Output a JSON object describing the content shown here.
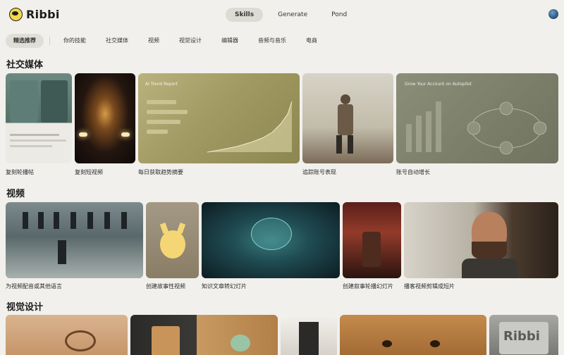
{
  "header": {
    "brand": "Ribbi",
    "tabs": [
      {
        "label": "Skills",
        "active": true
      },
      {
        "label": "Generate",
        "active": false
      },
      {
        "label": "Pond",
        "active": false
      }
    ]
  },
  "categories": [
    {
      "label": "精选推荐",
      "active": true
    },
    {
      "label": "你的技能",
      "active": false
    },
    {
      "label": "社交媒体",
      "active": false
    },
    {
      "label": "视频",
      "active": false
    },
    {
      "label": "视觉设计",
      "active": false
    },
    {
      "label": "编辑器",
      "active": false
    },
    {
      "label": "音频与音乐",
      "active": false
    },
    {
      "label": "电商",
      "active": false
    }
  ],
  "sections": {
    "social": {
      "title": "社交媒体",
      "cards": [
        {
          "label": "复刻轮播帖"
        },
        {
          "label": "复刻短视频"
        },
        {
          "label": "每日获取趋势摘要",
          "overlay_title": "AI Trend Report"
        },
        {
          "label": "追踪账号表现"
        },
        {
          "label": "账号自动增长",
          "overlay_title": "Grow Your Account on Autopilot"
        }
      ]
    },
    "video": {
      "title": "视频",
      "cards": [
        {
          "label": "为视频配音或其他语言"
        },
        {
          "label": "创建故事性视频"
        },
        {
          "label": "知识文章转幻灯片"
        },
        {
          "label": "创建叙事轮播幻灯片"
        },
        {
          "label": "播客视频剪辑成短片"
        }
      ]
    },
    "visual": {
      "title": "视觉设计",
      "cards": [
        {
          "label": ""
        },
        {
          "label": ""
        },
        {
          "label": ""
        },
        {
          "label": ""
        },
        {
          "label": "",
          "overlay_title": "Ribbi"
        }
      ]
    }
  },
  "colors": {
    "background": "#f1f0ec",
    "active_pill": "#dcdcd4",
    "brand_yellow": "#f2d84a"
  }
}
